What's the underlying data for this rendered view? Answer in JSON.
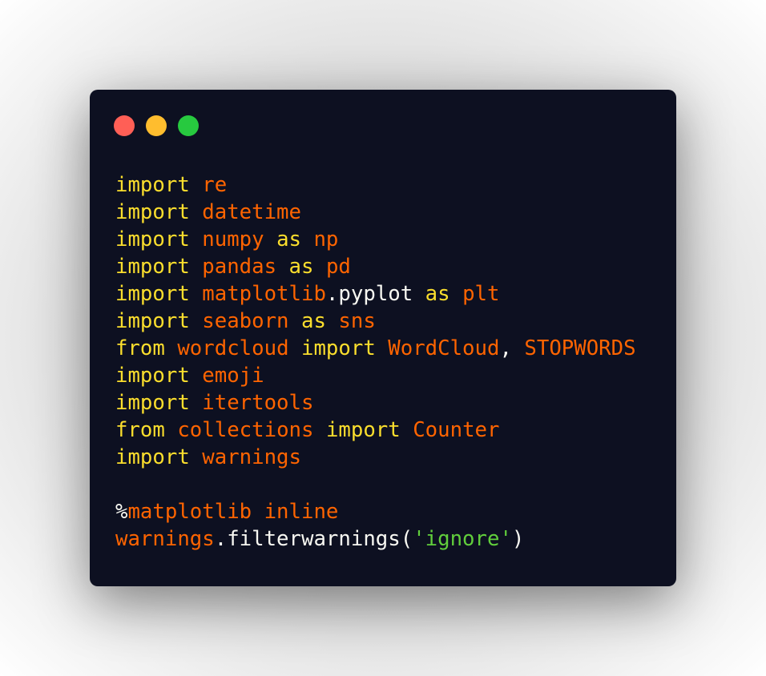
{
  "colors": {
    "background": "#0d1021",
    "keyword": "#fbde2d",
    "name": "#ff6400",
    "plain": "#f8f8f2",
    "string": "#61ce3c",
    "dot_close": "#ff5f56",
    "dot_minimize": "#ffbd2e",
    "dot_maximize": "#27c93f"
  },
  "window": {
    "buttons": [
      {
        "name": "close-dot",
        "color": "#ff5f56"
      },
      {
        "name": "minimize-dot",
        "color": "#ffbd2e"
      },
      {
        "name": "maximize-dot",
        "color": "#27c93f"
      }
    ]
  },
  "code": {
    "lines": [
      [
        {
          "t": "import",
          "k": "keyword"
        },
        {
          "t": " ",
          "k": "plain"
        },
        {
          "t": "re",
          "k": "name"
        }
      ],
      [
        {
          "t": "import",
          "k": "keyword"
        },
        {
          "t": " ",
          "k": "plain"
        },
        {
          "t": "datetime",
          "k": "name"
        }
      ],
      [
        {
          "t": "import",
          "k": "keyword"
        },
        {
          "t": " ",
          "k": "plain"
        },
        {
          "t": "numpy",
          "k": "name"
        },
        {
          "t": " ",
          "k": "plain"
        },
        {
          "t": "as",
          "k": "keyword"
        },
        {
          "t": " ",
          "k": "plain"
        },
        {
          "t": "np",
          "k": "name"
        }
      ],
      [
        {
          "t": "import",
          "k": "keyword"
        },
        {
          "t": " ",
          "k": "plain"
        },
        {
          "t": "pandas",
          "k": "name"
        },
        {
          "t": " ",
          "k": "plain"
        },
        {
          "t": "as",
          "k": "keyword"
        },
        {
          "t": " ",
          "k": "plain"
        },
        {
          "t": "pd",
          "k": "name"
        }
      ],
      [
        {
          "t": "import",
          "k": "keyword"
        },
        {
          "t": " ",
          "k": "plain"
        },
        {
          "t": "matplotlib",
          "k": "name"
        },
        {
          "t": ".pyplot",
          "k": "plain"
        },
        {
          "t": " ",
          "k": "plain"
        },
        {
          "t": "as",
          "k": "keyword"
        },
        {
          "t": " ",
          "k": "plain"
        },
        {
          "t": "plt",
          "k": "name"
        }
      ],
      [
        {
          "t": "import",
          "k": "keyword"
        },
        {
          "t": " ",
          "k": "plain"
        },
        {
          "t": "seaborn",
          "k": "name"
        },
        {
          "t": " ",
          "k": "plain"
        },
        {
          "t": "as",
          "k": "keyword"
        },
        {
          "t": " ",
          "k": "plain"
        },
        {
          "t": "sns",
          "k": "name"
        }
      ],
      [
        {
          "t": "from",
          "k": "keyword"
        },
        {
          "t": " ",
          "k": "plain"
        },
        {
          "t": "wordcloud",
          "k": "name"
        },
        {
          "t": " ",
          "k": "plain"
        },
        {
          "t": "import",
          "k": "keyword"
        },
        {
          "t": " ",
          "k": "plain"
        },
        {
          "t": "WordCloud",
          "k": "name"
        },
        {
          "t": ", ",
          "k": "plain"
        },
        {
          "t": "STOPWORDS",
          "k": "name"
        }
      ],
      [
        {
          "t": "import",
          "k": "keyword"
        },
        {
          "t": " ",
          "k": "plain"
        },
        {
          "t": "emoji",
          "k": "name"
        }
      ],
      [
        {
          "t": "import",
          "k": "keyword"
        },
        {
          "t": " ",
          "k": "plain"
        },
        {
          "t": "itertools",
          "k": "name"
        }
      ],
      [
        {
          "t": "from",
          "k": "keyword"
        },
        {
          "t": " ",
          "k": "plain"
        },
        {
          "t": "collections",
          "k": "name"
        },
        {
          "t": " ",
          "k": "plain"
        },
        {
          "t": "import",
          "k": "keyword"
        },
        {
          "t": " ",
          "k": "plain"
        },
        {
          "t": "Counter",
          "k": "name"
        }
      ],
      [
        {
          "t": "import",
          "k": "keyword"
        },
        {
          "t": " ",
          "k": "plain"
        },
        {
          "t": "warnings",
          "k": "name"
        }
      ],
      [],
      [
        {
          "t": "%",
          "k": "plain"
        },
        {
          "t": "matplotlib inline",
          "k": "name"
        }
      ],
      [
        {
          "t": "warnings",
          "k": "name"
        },
        {
          "t": ".filterwarnings(",
          "k": "plain"
        },
        {
          "t": "'ignore'",
          "k": "string"
        },
        {
          "t": ")",
          "k": "plain"
        }
      ]
    ]
  }
}
